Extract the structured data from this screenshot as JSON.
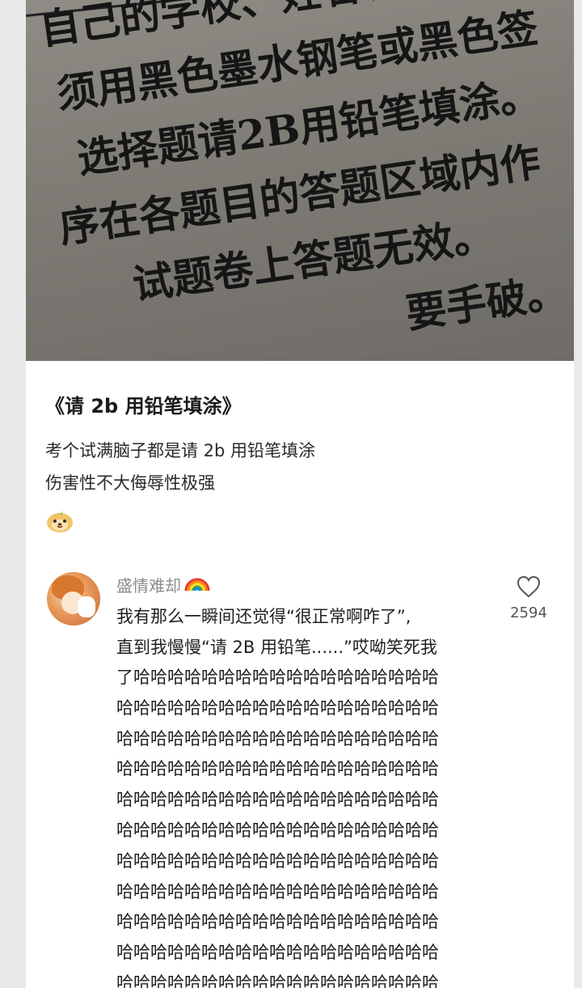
{
  "photo": {
    "lines": [
      "自己的学校、姓名、考号",
      "须用黑色墨水钢笔或黑色签",
      "选择题请2B用铅笔填涂。",
      "序在各题目的答题区域内作",
      "试题卷上答题无效。",
      "要手破。"
    ]
  },
  "post": {
    "title": "《请 2b 用铅笔填涂》",
    "body_line1": "考个试满脑子都是请 2b 用铅笔填涂",
    "body_line2": "伤害性不大侮辱性极强"
  },
  "comment": {
    "username": "盛情难却",
    "line1": "我有那么一瞬间还觉得“很正常啊咋了”,",
    "line2": "直到我慢慢“请 2B 用铅笔......”哎呦笑死我",
    "line3": "了哈哈哈哈哈哈哈哈哈哈哈哈哈哈哈哈哈哈",
    "haha_lines": [
      "哈哈哈哈哈哈哈哈哈哈哈哈哈哈哈哈哈哈哈",
      "哈哈哈哈哈哈哈哈哈哈哈哈哈哈哈哈哈哈哈",
      "哈哈哈哈哈哈哈哈哈哈哈哈哈哈哈哈哈哈哈",
      "哈哈哈哈哈哈哈哈哈哈哈哈哈哈哈哈哈哈哈",
      "哈哈哈哈哈哈哈哈哈哈哈哈哈哈哈哈哈哈哈",
      "哈哈哈哈哈哈哈哈哈哈哈哈哈哈哈哈哈哈哈",
      "哈哈哈哈哈哈哈哈哈哈哈哈哈哈哈哈哈哈哈",
      "哈哈哈哈哈哈哈哈哈哈哈哈哈哈哈哈哈哈哈",
      "哈哈哈哈哈哈哈哈哈哈哈哈哈哈哈哈哈哈哈",
      "哈哈哈哈哈哈哈哈哈哈哈哈哈哈哈哈哈哈哈"
    ],
    "like_count": "2594"
  },
  "colors": {
    "username": "#8c8c8c",
    "text": "#1f1f1f",
    "card": "#ffffff",
    "page": "#e9e9e9"
  },
  "icons": {
    "like": "heart-outline-icon",
    "sticker": "dog-face-sticker",
    "rainbow": "rainbow-emoji"
  }
}
